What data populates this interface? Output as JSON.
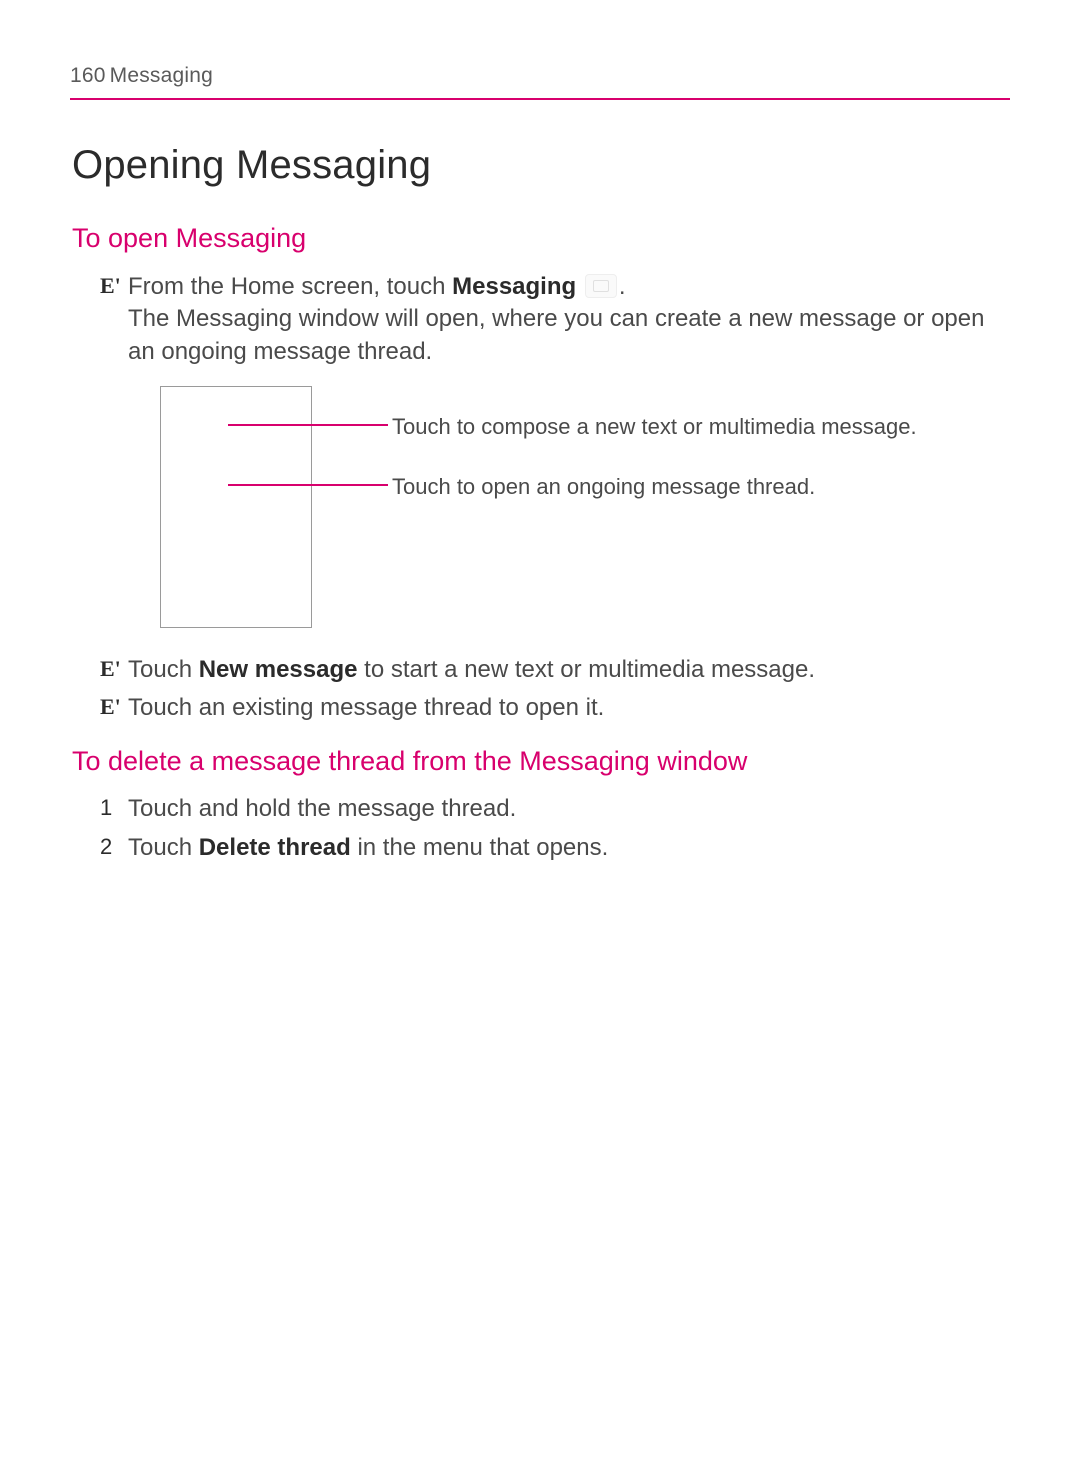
{
  "header": {
    "page_number": "160",
    "section": "Messaging"
  },
  "title": "Opening Messaging",
  "sections": {
    "open": {
      "heading": "To open Messaging",
      "step1_marker": "E'",
      "step1_prefix": "From the Home screen, touch ",
      "step1_bold": "Messaging",
      "step1_suffix": ".",
      "step1_cont": "The Messaging window will open, where you can create a new message or open an ongoing message thread.",
      "callout1": "Touch to compose a new text or multimedia message.",
      "callout2": "Touch to open an ongoing message thread.",
      "step2_marker": "E'",
      "step2_prefix": "Touch ",
      "step2_bold": "New message",
      "step2_suffix": " to start a new text or multimedia message.",
      "step3_marker": "E'",
      "step3_text": "Touch an existing message thread to open it."
    },
    "delete": {
      "heading": "To delete a message thread from the Messaging window",
      "n1": "1",
      "n1_text": "Touch and hold the message thread.",
      "n2": "2",
      "n2_prefix": "Touch ",
      "n2_bold": "Delete thread",
      "n2_suffix": " in the menu that opens."
    }
  }
}
